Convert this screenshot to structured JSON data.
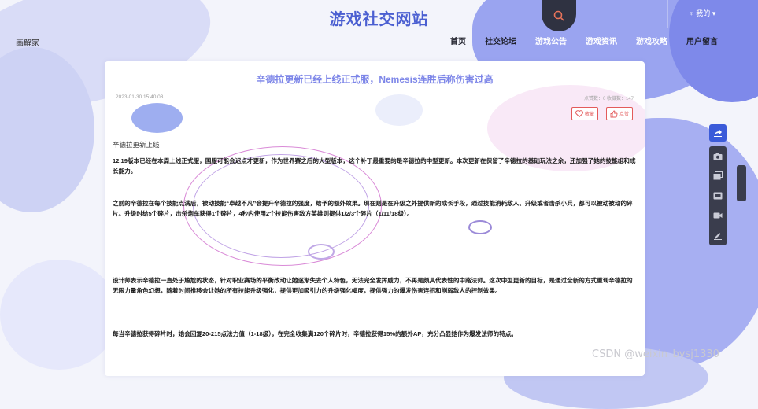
{
  "header": {
    "site_title": "游戏社交网站",
    "logo_text": "画解家",
    "user_label": "♀ 我的 ▾",
    "nav": [
      "首页",
      "社交论坛",
      "游戏公告",
      "游戏资讯",
      "游戏攻略",
      "用户留言"
    ]
  },
  "article": {
    "title": "辛德拉更新已经上线正式服，Nemesis连胜后称伤害过高",
    "date": "2023-01-30 15:40:03",
    "counts": "点赞数：0   收藏数：147",
    "fav_label": "收藏",
    "like_label": "点赞",
    "lead": "辛德拉更新上线",
    "paragraphs": [
      "12.19版本已经在本周上线正式服，国服可能会迟点才更新，作为世界赛之后的大型版本，这个补丁最重要的是辛德拉的中型更新。本次更新在保留了辛德拉的基础玩法之余，还加强了她的技能组和成长能力。",
      "之前的辛德拉在每个技能点满后，被动技能“卓越不凡”会提升辛德拉的强度，给予的额外效果。现在则是在升级之外提供新的成长手段，通过技能消耗敌人、升级或者击杀小兵，都可以被动被动的碎片。升级时给5个碎片，击杀炮车获得1个碎片，4秒内使用2个技能伤害敌方英雄则提供1/2/3个碎片（1/11/18级）。",
      "设计师表示辛德拉一直处于尴尬的状态，针对职业赛场的平衡改动让她逐渐失去个人特色，无法完全发挥威力，不再是颇具代表性的中路法师。这次中型更新的目标，是通过全新的方式重现辛德拉的无限力量角色幻想，随着时间推移会让她的所有技能升级强化，提供更加吸引力的升级强化幅度，提供强力的爆发伤害连招和削弱敌人的控制效果。",
      "每当辛德拉获得碎片时，她会回复20-215点法力值（1-18级），在完全收集满120个碎片时，辛德拉获得15%的额外AP，充分凸显她作为爆发法师的特点。"
    ]
  },
  "watermark": "CSDN @weixin_bysj1330",
  "colors": {
    "accent": "#3b5bd9",
    "title": "#4b5fd1",
    "danger": "#e35b5b"
  }
}
